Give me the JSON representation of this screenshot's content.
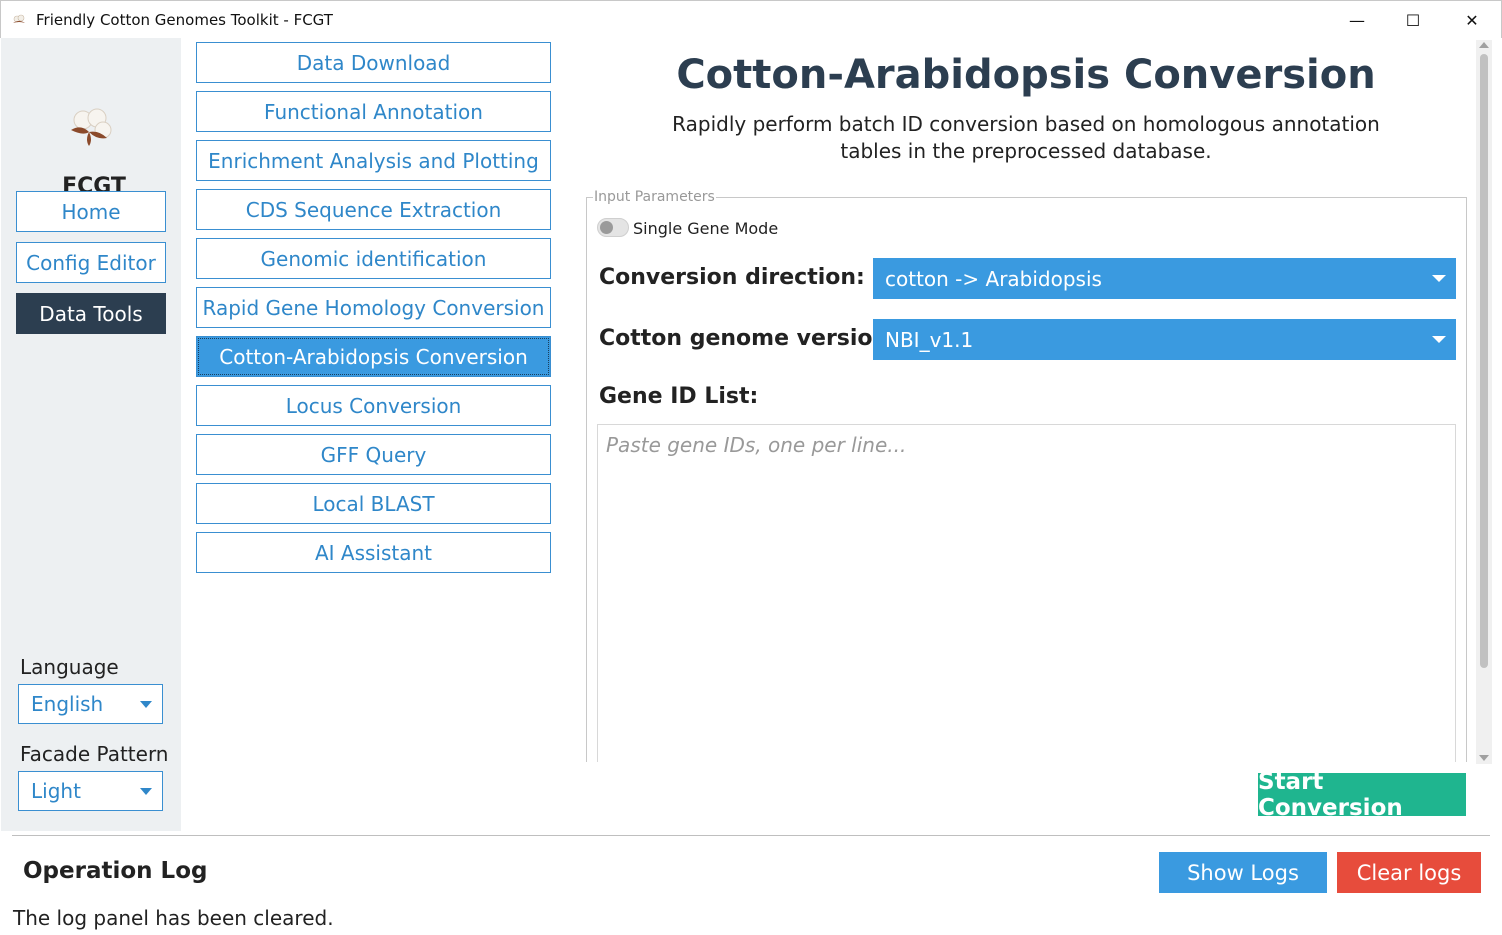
{
  "window": {
    "title": "Friendly Cotton Genomes Toolkit - FCGT",
    "minimize": "—",
    "maximize": "☐",
    "close": "✕"
  },
  "sidebar": {
    "brand": "FCGT",
    "nav": [
      {
        "label": "Home"
      },
      {
        "label": "Config Editor"
      },
      {
        "label": "Data Tools",
        "active": true
      }
    ],
    "language_label": "Language",
    "language_value": "English",
    "facade_label": "Facade Pattern",
    "facade_value": "Light"
  },
  "tools": [
    {
      "label": "Data Download"
    },
    {
      "label": "Functional Annotation"
    },
    {
      "label": "Enrichment Analysis and Plotting"
    },
    {
      "label": "CDS Sequence Extraction"
    },
    {
      "label": "Genomic identification"
    },
    {
      "label": "Rapid Gene Homology Conversion"
    },
    {
      "label": "Cotton-Arabidopsis Conversion",
      "active": true
    },
    {
      "label": "Locus Conversion"
    },
    {
      "label": "GFF Query"
    },
    {
      "label": "Local BLAST"
    },
    {
      "label": "AI Assistant"
    }
  ],
  "main": {
    "title": "Cotton-Arabidopsis Conversion",
    "subtitle": "Rapidly perform batch ID conversion based on homologous annotation tables in the preprocessed database.",
    "group_title": "Input Parameters",
    "single_gene_mode_label": "Single Gene Mode",
    "single_gene_mode_on": false,
    "direction_label": "Conversion direction:",
    "direction_value": "cotton -> Arabidopsis",
    "genome_label": "Cotton genome version:",
    "genome_value": "NBI_v1.1",
    "gene_list_label": "Gene ID List:",
    "gene_list_placeholder": "Paste gene IDs, one per line...",
    "start_button": "Start Conversion"
  },
  "log": {
    "title": "Operation Log",
    "show_button": "Show Logs",
    "clear_button": "Clear logs",
    "message": "The log panel has been cleared."
  },
  "colors": {
    "accent_blue": "#3a9ae0",
    "dark_nav": "#2c3e50",
    "start_green": "#1fb58f",
    "clear_red": "#e74c3c"
  }
}
